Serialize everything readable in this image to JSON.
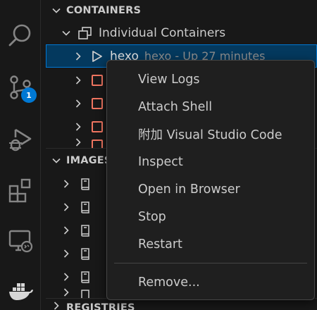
{
  "activity_bar": {
    "items": [
      {
        "icon": "search-icon"
      },
      {
        "icon": "source-control-icon",
        "badge": "1"
      },
      {
        "icon": "run-debug-icon"
      },
      {
        "icon": "extensions-icon"
      },
      {
        "icon": "remote-explorer-icon"
      },
      {
        "icon": "docker-icon"
      }
    ],
    "badge_color": "#0078d4"
  },
  "explorer": {
    "containers": {
      "header": "CONTAINERS",
      "group_label": "Individual Containers",
      "selected_item": {
        "name": "hexo",
        "description": "hexo - Up 27 minutes"
      }
    },
    "images": {
      "header": "IMAGES"
    },
    "registries": {
      "header": "REGISTRIES"
    },
    "container_icon_color": "#f07560"
  },
  "context_menu": {
    "items": [
      "View Logs",
      "Attach Shell",
      "附加 Visual Studio Code",
      "Inspect",
      "Open in Browser",
      "Stop",
      "Restart"
    ],
    "remove_label": "Remove..."
  }
}
